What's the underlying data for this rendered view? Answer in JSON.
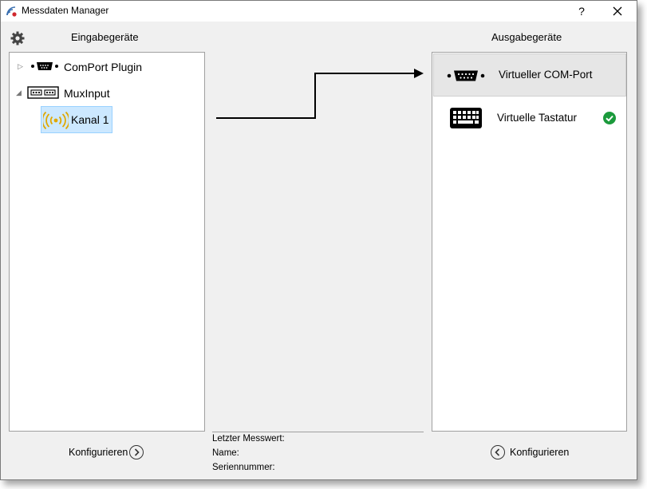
{
  "window": {
    "title": "Messdaten Manager",
    "help_label": "?",
    "close_label": "✕"
  },
  "input": {
    "heading": "Eingabegeräte",
    "tree": [
      {
        "label": "ComPort Plugin",
        "icon": "serial-port-icon",
        "expanded": false
      },
      {
        "label": "MuxInput",
        "icon": "mux-icon",
        "expanded": true,
        "children": [
          {
            "label": "Kanal 1",
            "icon": "radio-signal-icon",
            "selected": true
          }
        ]
      }
    ],
    "configure_label": "Konfigurieren"
  },
  "output": {
    "heading": "Ausgabegeräte",
    "items": [
      {
        "label": "Virtueller COM-Port",
        "icon": "serial-port-icon",
        "active": true
      },
      {
        "label": "Virtuelle Tastatur",
        "icon": "keyboard-icon",
        "status": "check-icon"
      }
    ],
    "configure_label": "Konfigurieren"
  },
  "info": {
    "last_value_label": "Letzter Messwert:",
    "name_label": "Name:",
    "serial_label": "Seriennummer:"
  },
  "colors": {
    "accent_selection": "#cce8ff",
    "signal_icon": "#e0a800",
    "check": "#1b9a3c"
  }
}
